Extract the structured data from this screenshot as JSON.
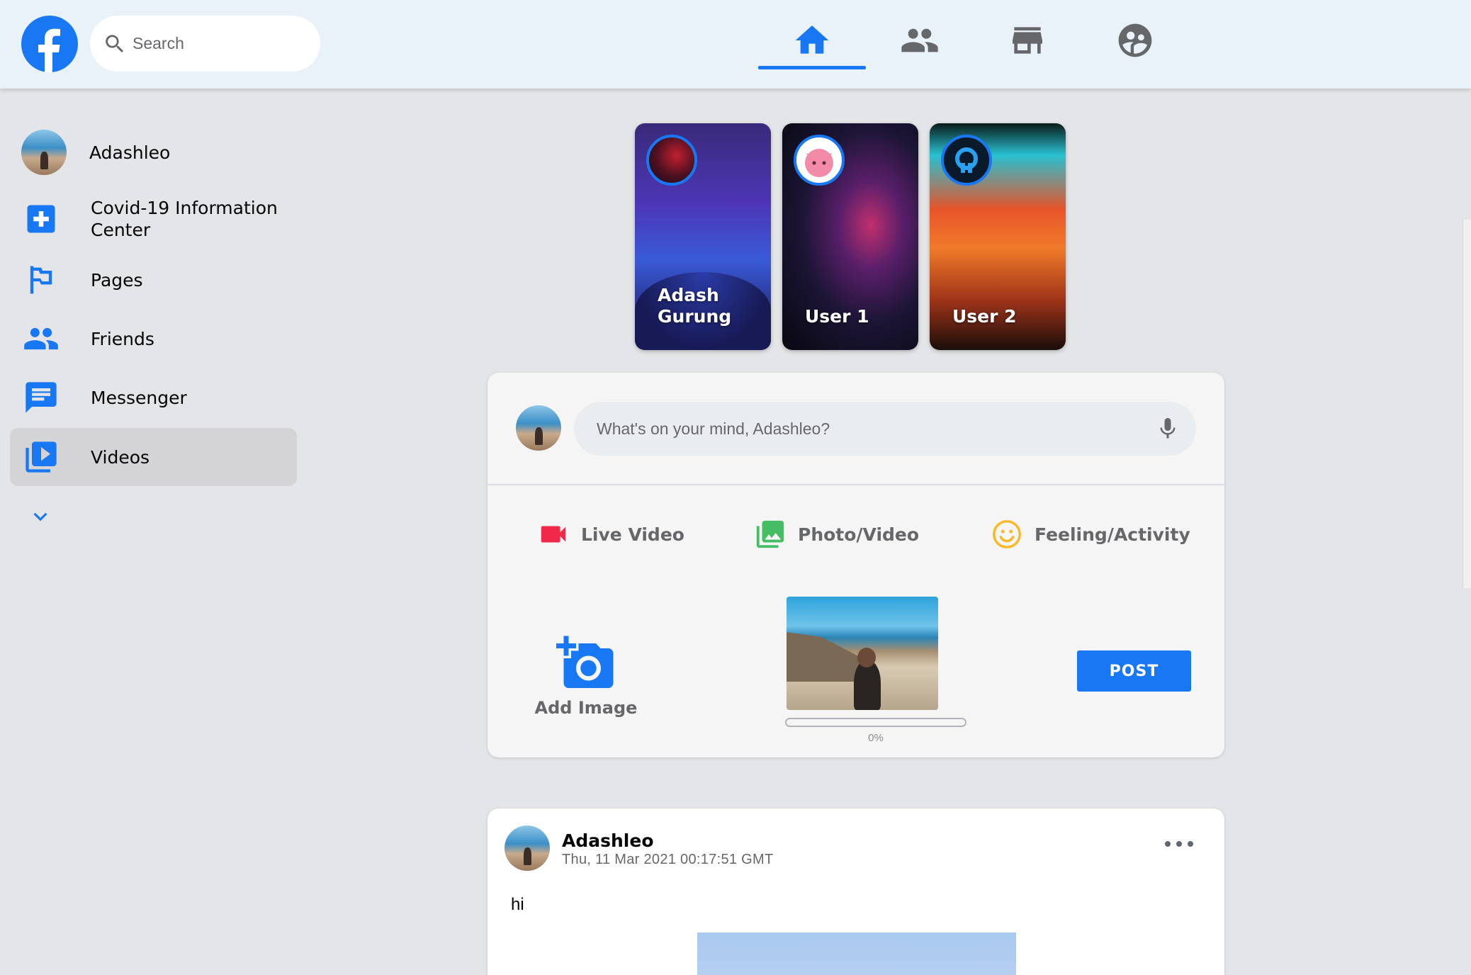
{
  "header": {
    "search_placeholder": "Search",
    "logo_icon": "facebook-logo",
    "nav_tabs": [
      {
        "name": "home",
        "icon": "home-icon",
        "active": true
      },
      {
        "name": "friends",
        "icon": "people-icon",
        "active": false
      },
      {
        "name": "marketplace",
        "icon": "store-icon",
        "active": false
      },
      {
        "name": "groups",
        "icon": "groups-icon",
        "active": false
      }
    ]
  },
  "sidebar": {
    "user": {
      "name": "Adashleo"
    },
    "items": [
      {
        "label": "Covid-19 Information Center",
        "icon": "plus-square-icon"
      },
      {
        "label": "Pages",
        "icon": "flag-icon"
      },
      {
        "label": "Friends",
        "icon": "people-icon"
      },
      {
        "label": "Messenger",
        "icon": "chat-icon"
      },
      {
        "label": "Videos",
        "icon": "video-library-icon",
        "active": true
      }
    ],
    "more_icon": "chevron-down-icon"
  },
  "stories": [
    {
      "name": "Adash Gurung"
    },
    {
      "name": "User 1"
    },
    {
      "name": "User 2"
    }
  ],
  "composer": {
    "placeholder": "What's on your mind, Adashleo?",
    "actions": [
      {
        "label": "Live Video",
        "icon": "video-camera-icon",
        "color": "#f02849"
      },
      {
        "label": "Photo/Video",
        "icon": "photo-icon",
        "color": "#45bd62"
      },
      {
        "label": "Feeling/Activity",
        "icon": "smile-icon",
        "color": "#f7b928"
      }
    ],
    "add_image_label": "Add Image",
    "upload_progress": 0,
    "upload_progress_text": "0%",
    "post_button": "POST"
  },
  "feed": [
    {
      "author": "Adashleo",
      "timestamp": "Thu, 11 Mar 2021 00:17:51 GMT",
      "text": "hi"
    }
  ],
  "colors": {
    "accent": "#1877f2",
    "background": "#e4e5e8",
    "header": "#e9f1f9"
  }
}
